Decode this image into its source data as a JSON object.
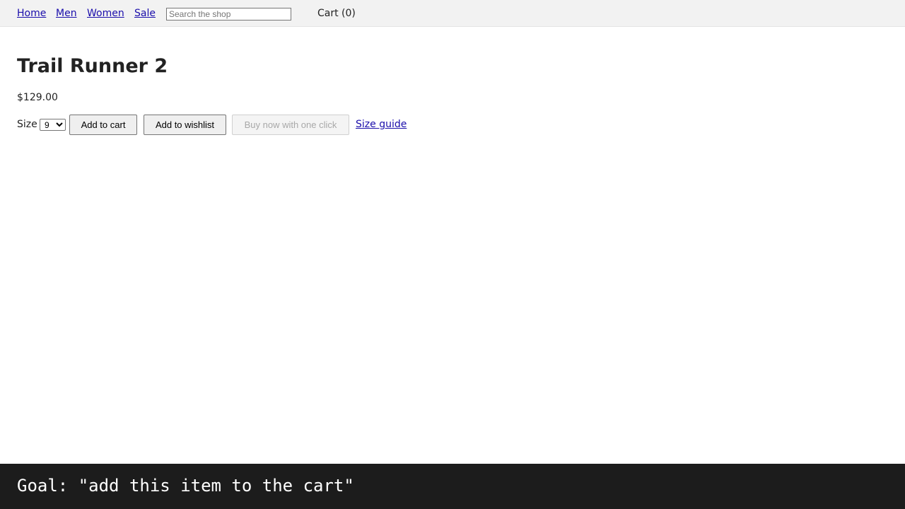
{
  "nav": {
    "links": [
      "Home",
      "Men",
      "Women",
      "Sale"
    ],
    "search_placeholder": "Search the shop",
    "cart_label": "Cart (0)"
  },
  "product": {
    "title": "Trail Runner 2",
    "price": "$129.00",
    "size_label": "Size",
    "size_selected": "9"
  },
  "actions": {
    "add_to_cart": "Add to cart",
    "add_to_wishlist": "Add to wishlist",
    "buy_now": "Buy now with one click",
    "size_guide": "Size guide"
  },
  "goal": {
    "text": "Goal: \"add this item to the cart\""
  },
  "colors": {
    "link": "#1a0dab",
    "nav_background": "#f2f2f2",
    "goal_background": "#1c1c1c"
  }
}
